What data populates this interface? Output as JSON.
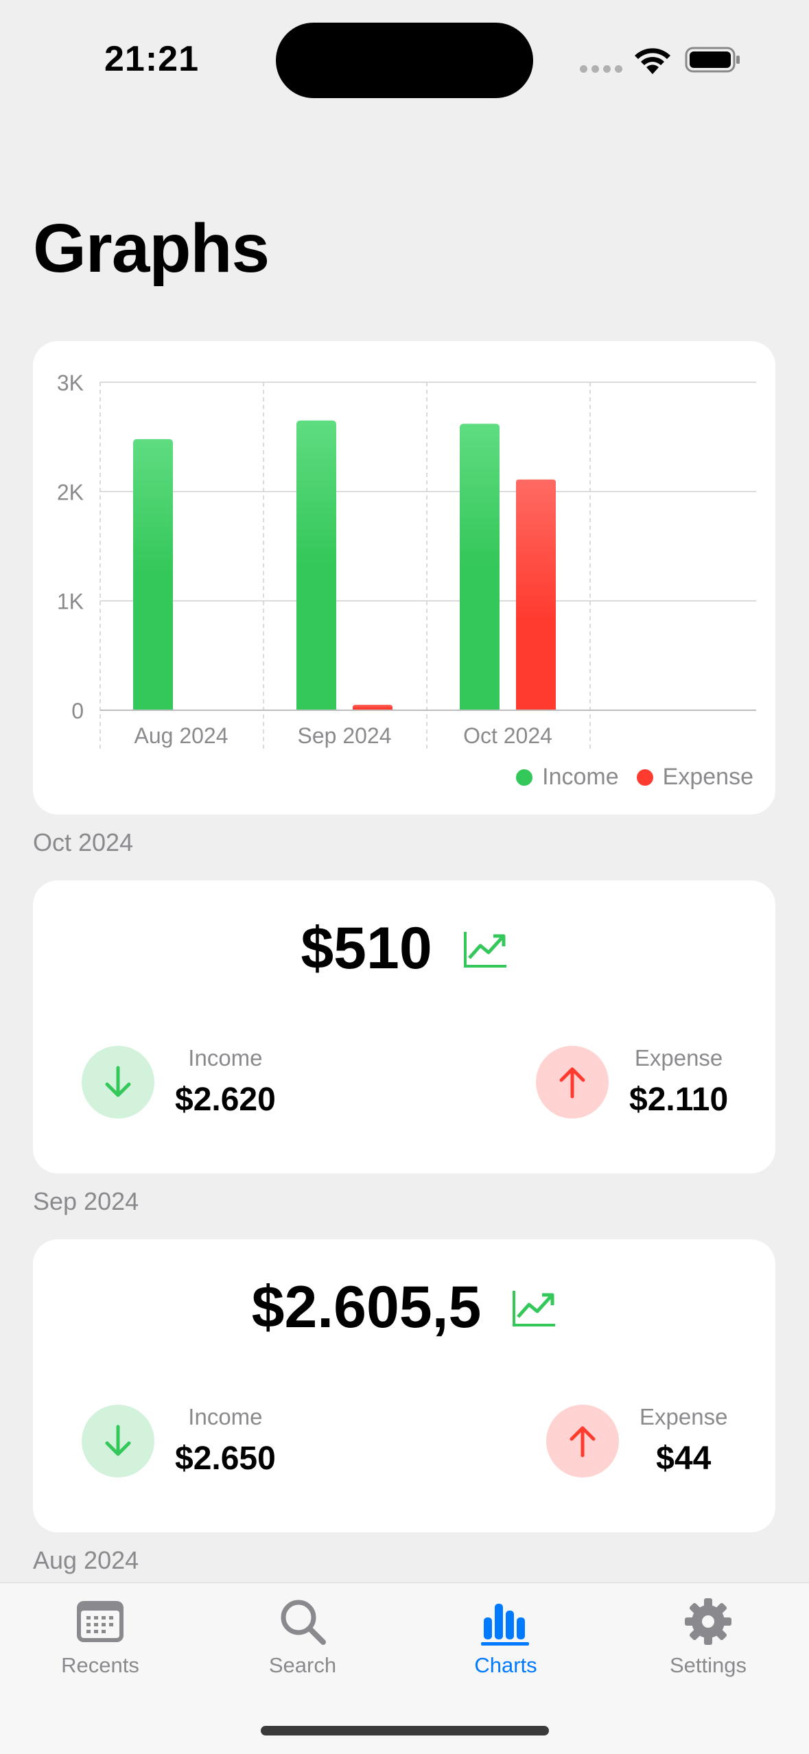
{
  "status_bar": {
    "time": "21:21"
  },
  "page": {
    "title": "Graphs"
  },
  "chart_data": {
    "type": "bar",
    "categories": [
      "Aug 2024",
      "Sep 2024",
      "Oct 2024"
    ],
    "series": [
      {
        "name": "Income",
        "values": [
          2480,
          2650,
          2620
        ],
        "color": "#34c759"
      },
      {
        "name": "Expense",
        "values": [
          0,
          44,
          2110
        ],
        "color": "#ff3b30"
      }
    ],
    "yticks": [
      "0",
      "1K",
      "2K",
      "3K"
    ],
    "ylim": [
      0,
      3000
    ],
    "grid": true,
    "legend": "bottom-right"
  },
  "summaries": [
    {
      "period": "Oct 2024",
      "net": "$510",
      "trend_icon": "chart-line-uptrend-icon",
      "income_label": "Income",
      "income_value": "$2.620",
      "expense_label": "Expense",
      "expense_value": "$2.110"
    },
    {
      "period": "Sep 2024",
      "net": "$2.605,5",
      "trend_icon": "chart-line-uptrend-icon",
      "income_label": "Income",
      "income_value": "$2.650",
      "expense_label": "Expense",
      "expense_value": "$44"
    }
  ],
  "next_section": "Aug 2024",
  "tabs": [
    {
      "label": "Recents",
      "icon": "calendar-icon",
      "active": false
    },
    {
      "label": "Search",
      "icon": "magnifyingglass-icon",
      "active": false
    },
    {
      "label": "Charts",
      "icon": "chart-bar-icon",
      "active": true
    },
    {
      "label": "Settings",
      "icon": "gear-icon",
      "active": false
    }
  ],
  "colors": {
    "income": "#34c759",
    "expense": "#ff3b30",
    "accent": "#007aff"
  }
}
